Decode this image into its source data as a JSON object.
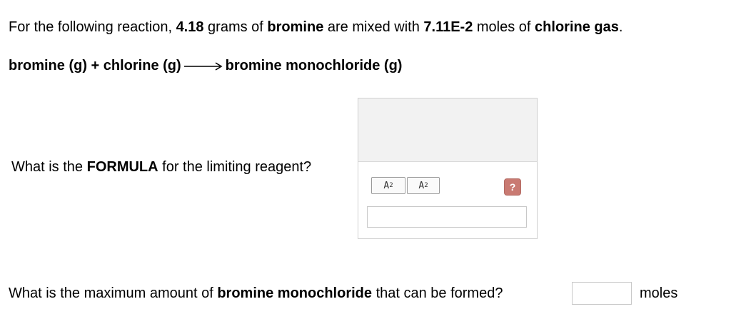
{
  "intro": {
    "t1": "For the following reaction, ",
    "mass": "4.18",
    "t2": " grams of ",
    "reactant1": "bromine",
    "t3": " are mixed with ",
    "moles": "7.11E-2",
    "t4": " moles of ",
    "reactant2": "chlorine gas",
    "t5": "."
  },
  "reaction": {
    "lhs": "bromine (g) + chlorine (g)",
    "rhs": "bromine monochloride (g)"
  },
  "question1": {
    "pre": "What is the ",
    "bold": "FORMULA",
    "post": " for the limiting reagent?"
  },
  "editor": {
    "subscript_label": "A",
    "subscript_mark": "2",
    "superscript_label": "A",
    "superscript_mark": "2",
    "help_label": "?",
    "formula_value": ""
  },
  "question2": {
    "pre": "What is the maximum amount of ",
    "bold": "bromine monochloride",
    "post": " that can be formed?",
    "answer_value": "",
    "unit": "moles"
  },
  "colors": {
    "help_button": "#c97a72",
    "editor_toolbar_bg": "#f2f2f2"
  }
}
